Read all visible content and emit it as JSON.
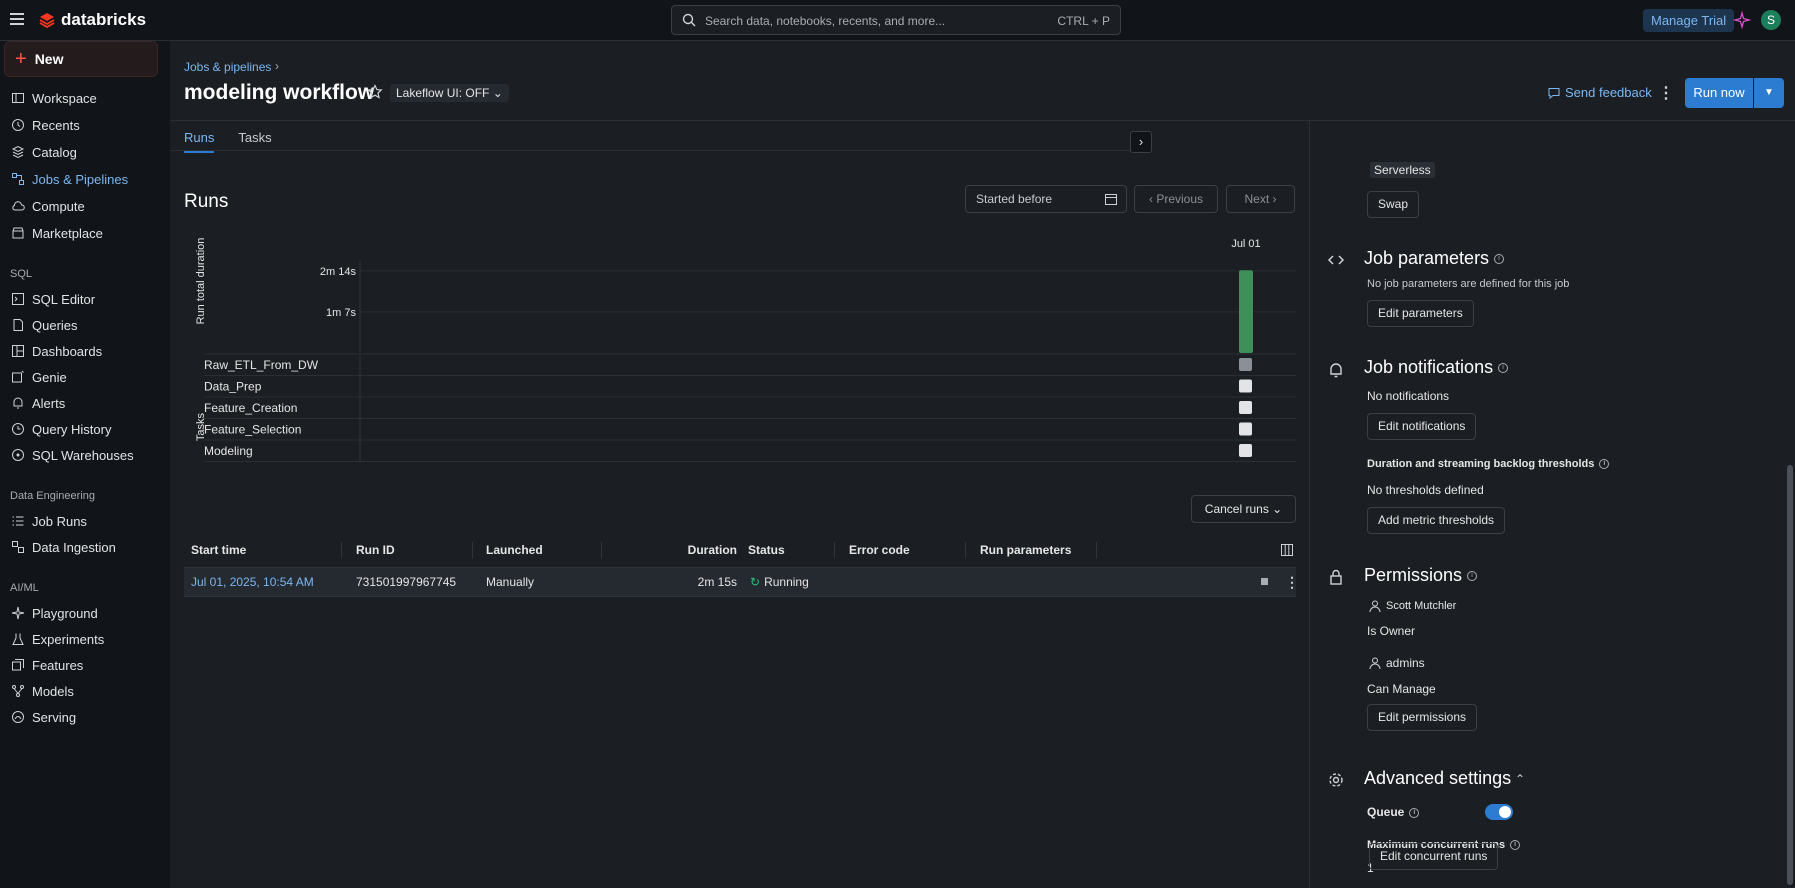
{
  "topbar": {
    "brand": "databricks",
    "search_placeholder": "Search data, notebooks, recents, and more...",
    "search_shortcut": "CTRL + P",
    "manage_trial": "Manage Trial",
    "avatar_initial": "S"
  },
  "sidebar": {
    "new_label": "New",
    "items": [
      {
        "label": "Workspace",
        "icon": "folder-icon"
      },
      {
        "label": "Recents",
        "icon": "clock-icon"
      },
      {
        "label": "Catalog",
        "icon": "catalog-icon"
      },
      {
        "label": "Jobs & Pipelines",
        "icon": "workflow-icon",
        "active": true
      },
      {
        "label": "Compute",
        "icon": "cloud-icon"
      },
      {
        "label": "Marketplace",
        "icon": "store-icon"
      }
    ],
    "sql_section": "SQL",
    "sql_items": [
      {
        "label": "SQL Editor",
        "icon": "editor-icon"
      },
      {
        "label": "Queries",
        "icon": "query-icon"
      },
      {
        "label": "Dashboards",
        "icon": "dashboard-icon"
      },
      {
        "label": "Genie",
        "icon": "genie-icon"
      },
      {
        "label": "Alerts",
        "icon": "bell-icon"
      },
      {
        "label": "Query History",
        "icon": "history-icon"
      },
      {
        "label": "SQL Warehouses",
        "icon": "warehouse-icon"
      }
    ],
    "de_section": "Data Engineering",
    "de_items": [
      {
        "label": "Job Runs",
        "icon": "list-icon"
      },
      {
        "label": "Data Ingestion",
        "icon": "ingest-icon"
      }
    ],
    "ml_section": "AI/ML",
    "ml_items": [
      {
        "label": "Playground",
        "icon": "sparkle-icon"
      },
      {
        "label": "Experiments",
        "icon": "flask-icon"
      },
      {
        "label": "Features",
        "icon": "features-icon"
      },
      {
        "label": "Models",
        "icon": "models-icon"
      },
      {
        "label": "Serving",
        "icon": "serving-icon"
      }
    ]
  },
  "header": {
    "breadcrumb": "Jobs & pipelines",
    "breadcrumb_sep": "›",
    "title": "modeling workflow",
    "lakeflow_toggle": "Lakeflow UI: OFF",
    "send_feedback": "Send feedback",
    "run_now": "Run now"
  },
  "tabs": [
    "Runs",
    "Tasks"
  ],
  "runs": {
    "title": "Runs",
    "started_before": "Started before",
    "previous": "Previous",
    "next": "Next",
    "cancel_runs": "Cancel runs"
  },
  "chart_data": {
    "type": "bar",
    "categories": [
      "Jul 01"
    ],
    "values": [
      135
    ],
    "ylabel": "Run total duration",
    "yticks": [
      {
        "label": "2m 14s",
        "value": 134
      },
      {
        "label": "1m 7s",
        "value": 67
      }
    ],
    "ylim": [
      0,
      150
    ],
    "bar_color": "#3f8f5b",
    "tasks_label": "Tasks",
    "tasks": [
      {
        "name": "Raw_ETL_From_DW",
        "state": "done"
      },
      {
        "name": "Data_Prep",
        "state": "pending"
      },
      {
        "name": "Feature_Creation",
        "state": "pending"
      },
      {
        "name": "Feature_Selection",
        "state": "pending"
      },
      {
        "name": "Modeling",
        "state": "pending"
      }
    ]
  },
  "table": {
    "columns": [
      "Start time",
      "Run ID",
      "Launched",
      "Duration",
      "Status",
      "Error code",
      "Run parameters"
    ],
    "rows": [
      {
        "start_time": "Jul 01, 2025, 10:54 AM",
        "run_id": "731501997967745",
        "launched": "Manually",
        "duration": "2m 15s",
        "status": "Running",
        "error_code": "",
        "run_parameters": ""
      }
    ]
  },
  "right_panel": {
    "compute_type": "Serverless",
    "swap": "Swap",
    "job_params_title": "Job parameters",
    "job_params_text": "No job parameters are defined for this job",
    "edit_params": "Edit parameters",
    "notif_title": "Job notifications",
    "notif_text": "No notifications",
    "edit_notif": "Edit notifications",
    "thresholds_title": "Duration and streaming backlog thresholds",
    "thresholds_text": "No thresholds defined",
    "add_thresholds": "Add metric thresholds",
    "perm_title": "Permissions",
    "perm_user": "Scott Mutchler",
    "perm_user_role": "Is Owner",
    "perm_group": "admins",
    "perm_group_role": "Can Manage",
    "edit_perm": "Edit permissions",
    "adv_title": "Advanced settings",
    "queue_label": "Queue",
    "queue_enabled": true,
    "max_runs_label": "Maximum concurrent runs",
    "max_runs_value": "1",
    "edit_concurrent": "Edit concurrent runs"
  }
}
